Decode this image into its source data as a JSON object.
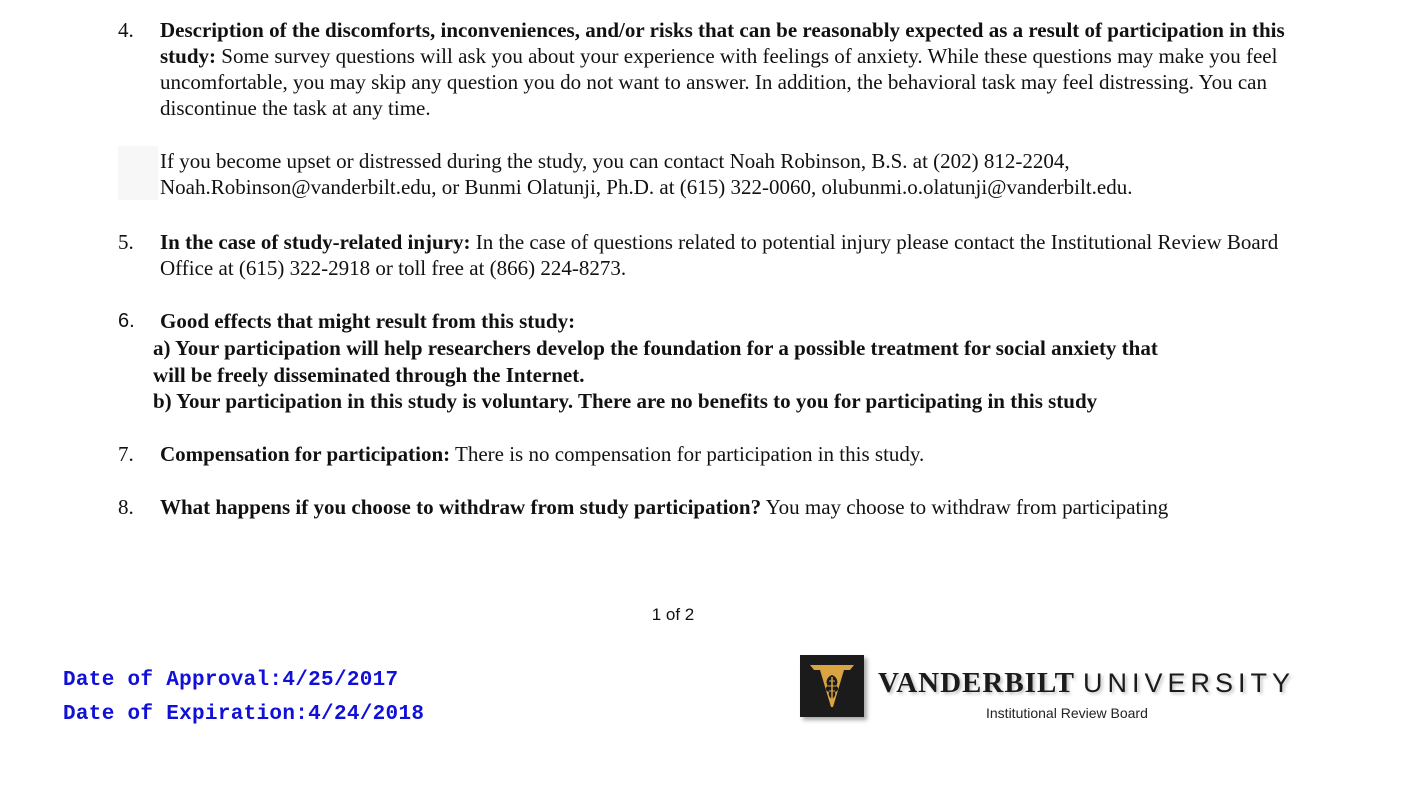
{
  "items": [
    {
      "number": "4.",
      "heading": "Description of the discomforts, inconveniences, and/or risks that can be reasonably expected as a result of participation in this study:",
      "body": " Some survey questions will ask you about your experience with feelings of anxiety. While these questions may make you feel uncomfortable, you may skip any question you do not want to answer. In addition, the behavioral task may feel distressing. You can discontinue the task at any time."
    },
    {
      "number": "5.",
      "heading": "In the case of study-related injury:",
      "body": " In the case of questions related to potential injury please contact the Institutional Review Board Office at (615) 322-2918 or toll free at (866) 224-8273."
    },
    {
      "number": "6.",
      "heading": "Good effects that might result from this study:",
      "body": ""
    },
    {
      "number": "7.",
      "heading": "Compensation for participation:",
      "body": " There is no compensation for participation in this study."
    },
    {
      "number": "8.",
      "heading": "What happens if you choose to withdraw from study participation?",
      "body": " You may choose to withdraw from participating"
    }
  ],
  "contact_paragraph": {
    "line1": "If you become upset or distressed during the study, you can contact Noah Robinson, B.S. at (202) 812-2204,",
    "line2": "Noah.Robinson@vanderbilt.edu, or Bunmi Olatunji, Ph.D. at (615) 322-0060, olubunmi.o.olatunji@vanderbilt.edu."
  },
  "benefits": {
    "a_line1": "a) Your participation will help researchers develop the foundation for a possible treatment for social anxiety that",
    "a_line2": "will be freely disseminated through the Internet.",
    "b": "b) Your participation in this study is voluntary. There are no benefits to you for participating in this study"
  },
  "page_indicator": "1 of 2",
  "stamp": {
    "approval": "Date of Approval:4/25/2017",
    "expiration": "Date of Expiration:4/24/2018",
    "color": "#1010d8"
  },
  "logo": {
    "word_vanderbilt": "VANDERBILT",
    "word_university": "UNIVERSITY",
    "subtitle": "Institutional Review Board",
    "icon": "vanderbilt-oak-leaf-icon",
    "accent": "#d9a441"
  }
}
